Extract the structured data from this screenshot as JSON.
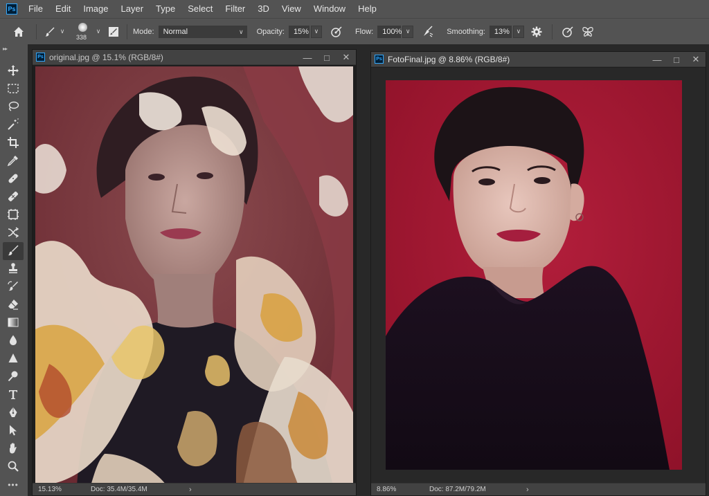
{
  "app": {
    "logo": "Ps"
  },
  "menu": [
    "File",
    "Edit",
    "Image",
    "Layer",
    "Type",
    "Select",
    "Filter",
    "3D",
    "View",
    "Window",
    "Help"
  ],
  "options": {
    "brush_size": "338",
    "mode_label": "Mode:",
    "mode_value": "Normal",
    "opacity_label": "Opacity:",
    "opacity_value": "15%",
    "flow_label": "Flow:",
    "flow_value": "100%",
    "smoothing_label": "Smoothing:",
    "smoothing_value": "13%"
  },
  "tools": [
    {
      "name": "move-tool",
      "icon": "move-icon"
    },
    {
      "name": "marquee-tool",
      "icon": "marquee-icon"
    },
    {
      "name": "lasso-tool",
      "icon": "lasso-icon"
    },
    {
      "name": "magic-wand-tool",
      "icon": "magic-wand-icon"
    },
    {
      "name": "crop-tool",
      "icon": "crop-icon"
    },
    {
      "name": "eyedropper-tool",
      "icon": "eyedropper-icon"
    },
    {
      "name": "spot-healing-tool",
      "icon": "bandage-icon"
    },
    {
      "name": "healing-brush-tool",
      "icon": "patch-icon"
    },
    {
      "name": "frame-tool",
      "icon": "frame-icon"
    },
    {
      "name": "content-aware-move-tool",
      "icon": "cross-arrows-icon"
    },
    {
      "name": "brush-tool",
      "icon": "brush-icon",
      "active": true
    },
    {
      "name": "clone-stamp-tool",
      "icon": "stamp-icon"
    },
    {
      "name": "history-brush-tool",
      "icon": "history-brush-icon"
    },
    {
      "name": "eraser-tool",
      "icon": "eraser-icon"
    },
    {
      "name": "gradient-tool",
      "icon": "gradient-icon"
    },
    {
      "name": "blur-tool",
      "icon": "drop-icon"
    },
    {
      "name": "sharpen-tool",
      "icon": "triangle-icon"
    },
    {
      "name": "dodge-tool",
      "icon": "dodge-icon"
    },
    {
      "name": "type-tool",
      "icon": "type-icon"
    },
    {
      "name": "pen-tool",
      "icon": "pen-icon"
    },
    {
      "name": "path-selection-tool",
      "icon": "arrow-icon"
    },
    {
      "name": "hand-tool",
      "icon": "hand-icon"
    },
    {
      "name": "zoom-tool",
      "icon": "zoom-icon"
    }
  ],
  "documents": {
    "original": {
      "title": "original.jpg @ 15.1% (RGB/8#)",
      "zoom": "15.13%",
      "doc_info": "Doc: 35.4M/35.4M"
    },
    "final": {
      "title": "FotoFinal.jpg @ 8.86% (RGB/8#)",
      "zoom": "8.86%",
      "doc_info": "Doc: 87.2M/79.2M"
    }
  },
  "colors": {
    "ui_dark": "#535353",
    "ui_panel": "#424242",
    "photo_bg_red": "#a81a35",
    "accent_blue": "#31a8ff"
  }
}
